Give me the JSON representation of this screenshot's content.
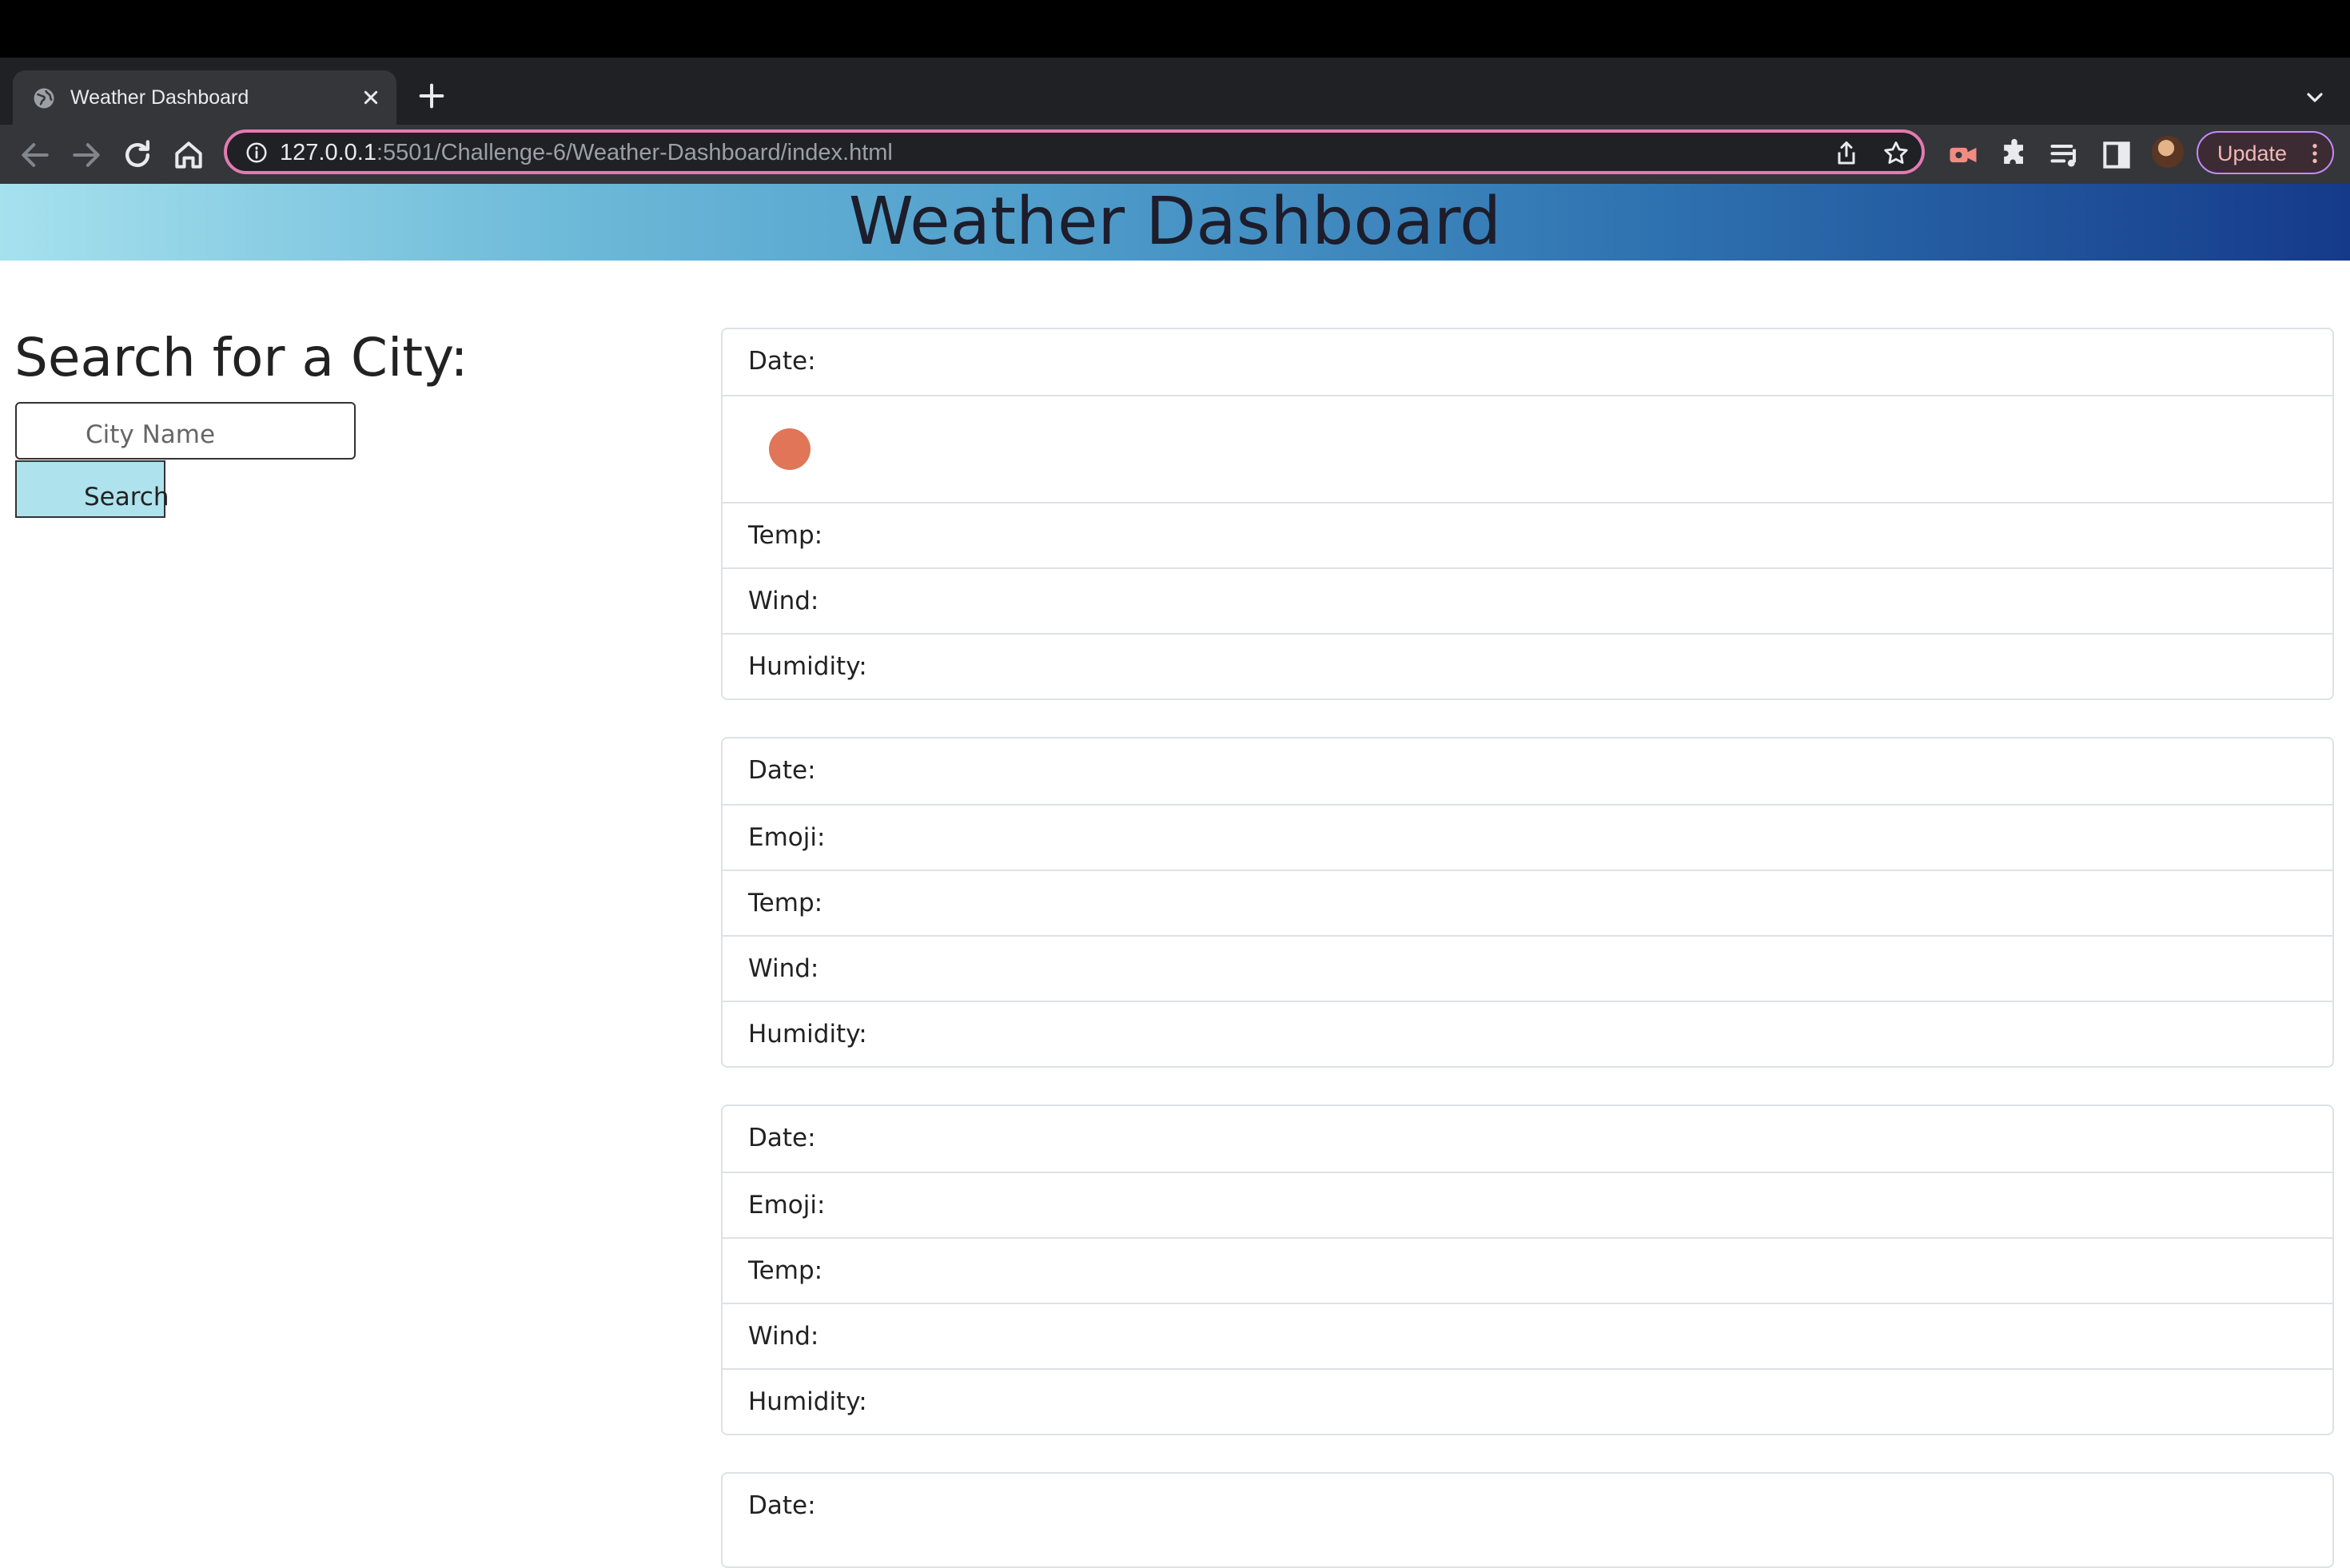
{
  "browser": {
    "tab_title": "Weather Dashboard",
    "url_host": "127.0.0.1",
    "url_rest": ":5501/Challenge-6/Weather-Dashboard/index.html",
    "update_label": "Update",
    "icons": [
      "globe-icon",
      "close-icon",
      "plus-icon",
      "chevron-down-icon",
      "back-arrow-icon",
      "forward-arrow-icon",
      "reload-icon",
      "home-icon",
      "info-icon",
      "share-icon",
      "star-icon",
      "screencast-extension-icon",
      "puzzle-icon",
      "media-queue-icon",
      "side-panel-icon",
      "avatar",
      "more-vert-icon"
    ],
    "colors": {
      "omnibox_border": "#e27bb1",
      "update_text": "#f2b8b5"
    }
  },
  "header": {
    "title": "Weather Dashboard"
  },
  "search": {
    "heading": "Search for a City:",
    "placeholder": "City Name",
    "button_label": "Search"
  },
  "cards": [
    {
      "date": "Date:",
      "emoji_color": "#e07558",
      "temp": "Temp:",
      "wind": "Wind:",
      "humidity": "Humidity:"
    },
    {
      "date": "Date:",
      "emoji": "Emoji:",
      "temp": "Temp:",
      "wind": "Wind:",
      "humidity": "Humidity:"
    },
    {
      "date": "Date:",
      "emoji": "Emoji:",
      "temp": "Temp:",
      "wind": "Wind:",
      "humidity": "Humidity:"
    },
    {
      "date": "Date:"
    }
  ]
}
